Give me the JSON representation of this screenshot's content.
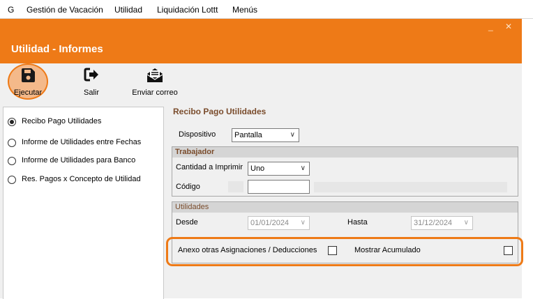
{
  "menubar": {
    "items": [
      "G",
      "Gestión de Vacación",
      "Utilidad",
      "Liquidación Lottt",
      "Menús"
    ]
  },
  "window": {
    "title": "Utilidad - Informes",
    "minimize": "_",
    "close": "✕",
    "accent": "#ee7a17"
  },
  "toolbar": {
    "execute_label": "Ejecutar",
    "exit_label": "Salir",
    "email_label": "Enviar correo"
  },
  "report_options": {
    "selected": "Recibo Pago Utilidades",
    "items": [
      "Recibo Pago Utilidades",
      "Informe de Utilidades entre Fechas",
      "Informe de Utilidades para Banco",
      "Res. Pagos x Concepto de Utilidad"
    ]
  },
  "form": {
    "section_title": "Recibo Pago Utilidades",
    "device_label": "Dispositivo",
    "device_value": "Pantalla",
    "worker_group_title": "Trabajador",
    "quantity_label": "Cantidad a Imprimir",
    "quantity_value": "Uno",
    "code_label": "Código",
    "code_value": "",
    "utilities_group_title": "Utilidades",
    "from_label": "Desde",
    "from_value": "01/01/2024",
    "to_label": "Hasta",
    "to_value": "31/12/2024",
    "annex_label": "Anexo otras Asignaciones / Deducciones",
    "annex_checked": false,
    "accumulated_label": "Mostrar Acumulado",
    "accumulated_checked": false
  }
}
